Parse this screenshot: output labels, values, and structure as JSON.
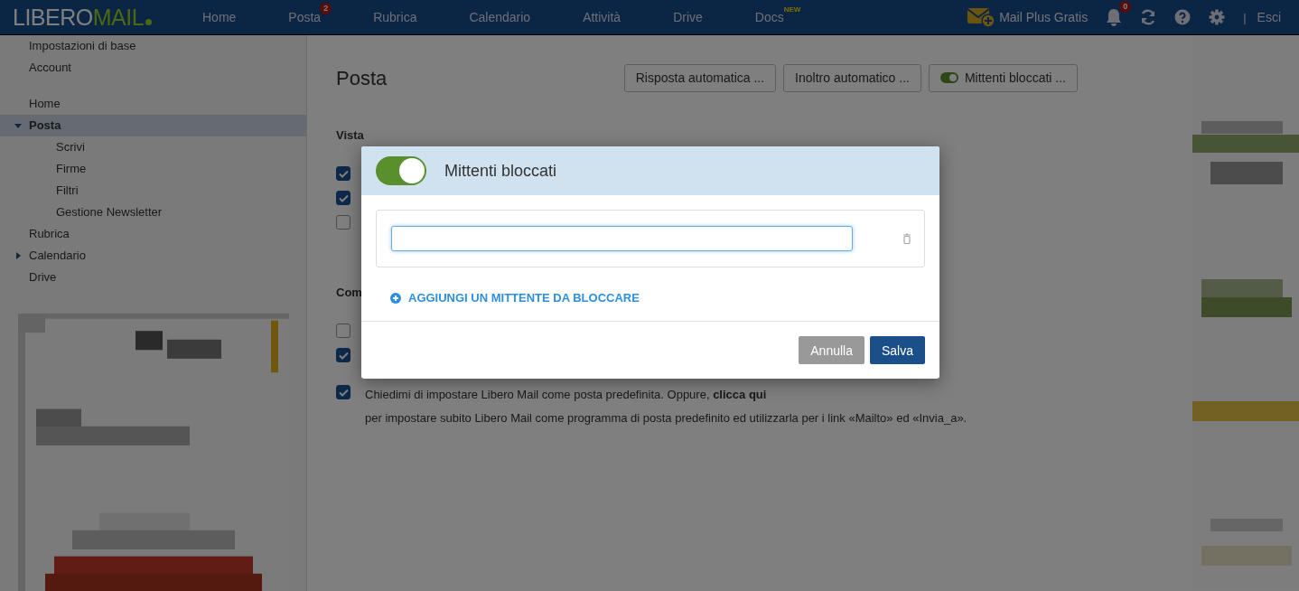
{
  "topbar": {
    "logo": {
      "part_1": "LIBERO",
      "part_2": "MAIL"
    },
    "nav": [
      {
        "label": "Home"
      },
      {
        "label": "Posta",
        "badge": "2"
      },
      {
        "label": "Rubrica"
      },
      {
        "label": "Calendario"
      },
      {
        "label": "Attività"
      },
      {
        "label": "Drive"
      },
      {
        "label": "Docs",
        "tag": "NEW"
      }
    ],
    "promo": "Mail Plus Gratis",
    "notifications_badge": "0",
    "separator": "|",
    "logout": "Esci"
  },
  "sidebar": {
    "groups": [
      [
        {
          "label": "Impostazioni di base"
        },
        {
          "label": "Account"
        }
      ],
      [
        {
          "label": "Home"
        },
        {
          "label": "Posta",
          "selected": true,
          "expanded": true,
          "children": [
            {
              "label": "Scrivi"
            },
            {
              "label": "Firme"
            },
            {
              "label": "Filtri"
            },
            {
              "label": "Gestione Newsletter"
            }
          ]
        },
        {
          "label": "Rubrica"
        },
        {
          "label": "Calendario",
          "expanded": false
        },
        {
          "label": "Drive"
        }
      ]
    ]
  },
  "main": {
    "title": "Posta",
    "toolbar": [
      {
        "label": "Risposta automatica ..."
      },
      {
        "label": "Inoltro automatico ..."
      },
      {
        "label": "Mittenti bloccati ...",
        "toggle_on": true
      }
    ],
    "sections": [
      {
        "heading": "Vista",
        "options": [
          {
            "checked": true
          },
          {
            "checked": true
          },
          {
            "checked": false
          }
        ]
      },
      {
        "heading": "Com",
        "options": [
          {
            "checked": false
          },
          {
            "checked": true
          },
          {
            "checked": true,
            "text": "Chiedimi di impostare Libero Mail come posta predefinita. Oppure, ",
            "link": "clicca qui",
            "text_2": "per impostare subito Libero Mail come programma di posta predefinito ed utilizzarla per i link «Mailto» ed «Invia_a»."
          }
        ]
      }
    ]
  },
  "dialog": {
    "title": "Mittenti bloccati",
    "toggle_on": true,
    "entries": [
      {
        "kind": "email"
      }
    ],
    "add_link": "AGGIUNGI UN MITTENTE DA BLOCCARE",
    "buttons": [
      {
        "label": "Annulla",
        "kind": "secondary"
      },
      {
        "label": "Salva",
        "kind": "primary"
      }
    ]
  }
}
